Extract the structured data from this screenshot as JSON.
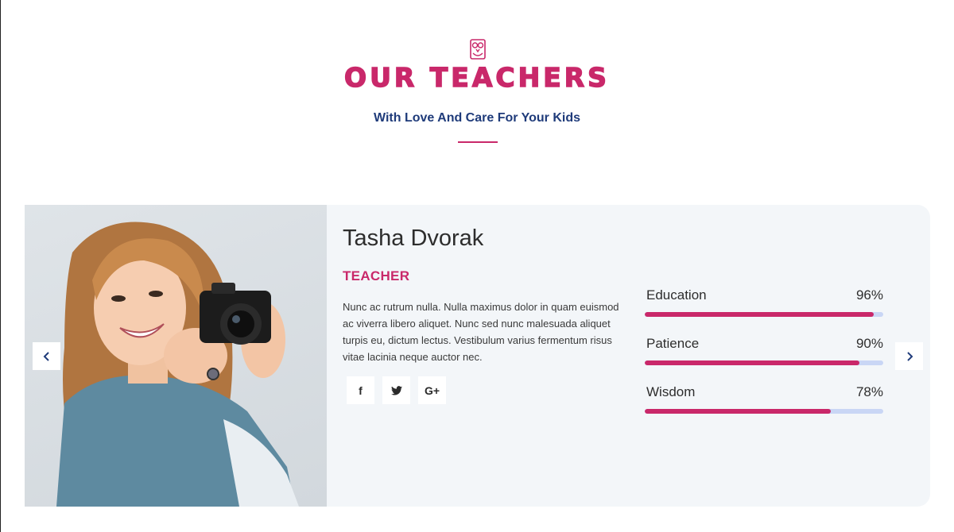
{
  "header": {
    "title": "OUR TEACHERS",
    "subtitle": "With Love And Care For Your Kids"
  },
  "teacher": {
    "name": "Tasha Dvorak",
    "role": "TEACHER",
    "bio": "Nunc ac rutrum nulla. Nulla maximus dolor in quam euismod ac viverra libero aliquet. Nunc sed nunc malesuada aliquet turpis eu, dictum lectus. Vestibulum varius fermentum risus vitae lacinia neque auctor nec.",
    "social": [
      {
        "icon": "facebook-icon",
        "glyph": "f"
      },
      {
        "icon": "twitter-icon",
        "glyph": "🐦"
      },
      {
        "icon": "google-plus-icon",
        "glyph": "G+"
      }
    ],
    "skills": [
      {
        "label": "Education",
        "value_text": "96%",
        "value": 96
      },
      {
        "label": "Patience",
        "value_text": "90%",
        "value": 90
      },
      {
        "label": "Wisdom",
        "value_text": "78%",
        "value": 78
      }
    ]
  },
  "carousel": {
    "prev_icon": "chevron-left-icon",
    "next_icon": "chevron-right-icon"
  },
  "colors": {
    "accent": "#c9286a",
    "subtitle": "#1f3b7a",
    "card_bg": "#f3f6f9",
    "track": "#c9d6f5"
  }
}
